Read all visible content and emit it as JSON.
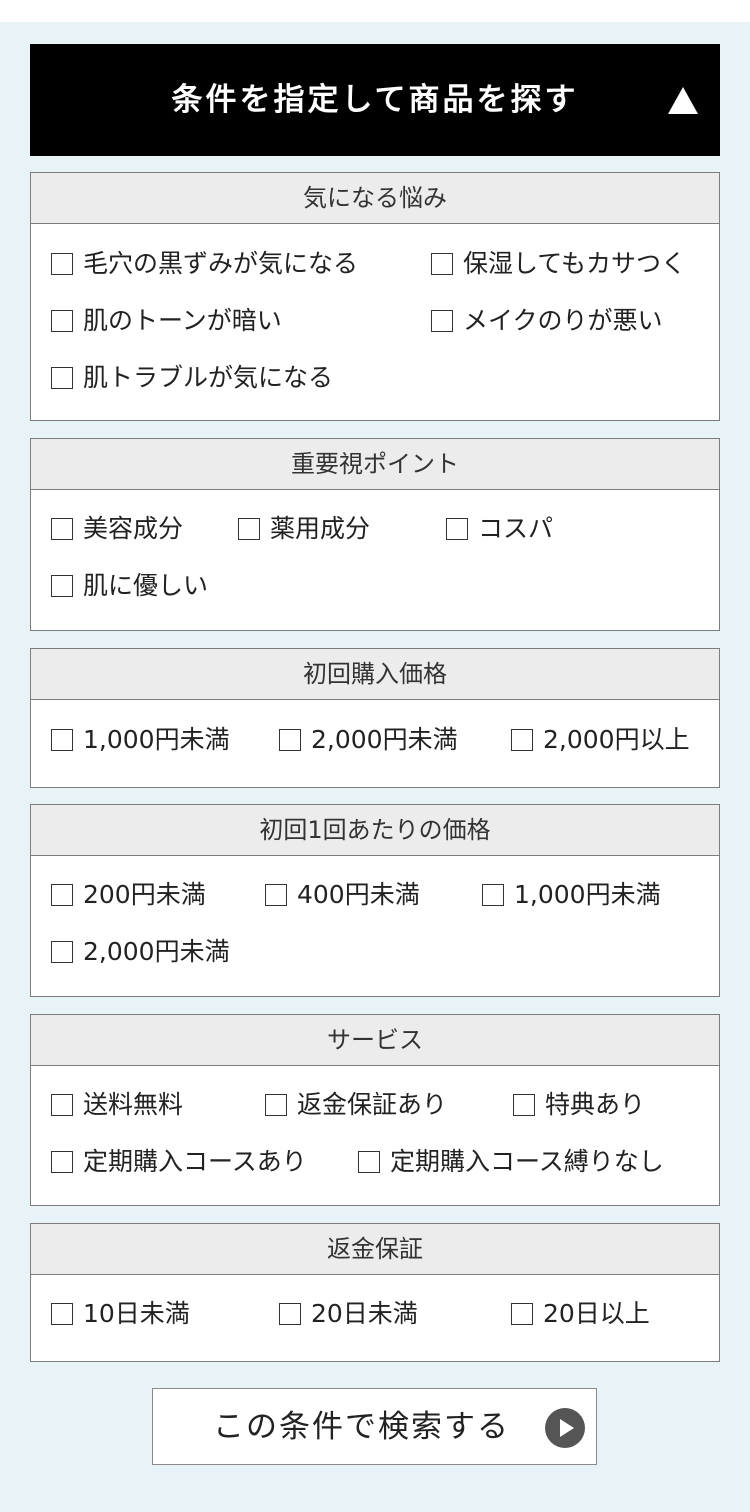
{
  "header": {
    "title": "条件を指定して商品を探す",
    "toggle_icon": "collapse-triangle-icon"
  },
  "sections": [
    {
      "title": "気になる悩み",
      "options": [
        "毛穴の黒ずみが気になる",
        "保湿してもカサつく",
        "肌のトーンが暗い",
        "メイクのりが悪い",
        "肌トラブルが気になる"
      ]
    },
    {
      "title": "重要視ポイント",
      "options": [
        "美容成分",
        "薬用成分",
        "コスパ",
        "肌に優しい"
      ]
    },
    {
      "title": "初回購入価格",
      "options": [
        "1,000円未満",
        "2,000円未満",
        "2,000円以上"
      ]
    },
    {
      "title": "初回1回あたりの価格",
      "options": [
        "200円未満",
        "400円未満",
        "1,000円未満",
        "2,000円未満"
      ]
    },
    {
      "title": "サービス",
      "options": [
        "送料無料",
        "返金保証あり",
        "特典あり",
        "定期購入コースあり",
        "定期購入コース縛りなし"
      ]
    },
    {
      "title": "返金保証",
      "options": [
        "10日未満",
        "20日未満",
        "20日以上"
      ]
    }
  ],
  "search_button": {
    "label": "この条件で検索する",
    "icon": "play-circle-icon"
  },
  "colors": {
    "page_background": "#e8f3f8",
    "header_background": "#000000",
    "section_title_background": "#ececec"
  }
}
